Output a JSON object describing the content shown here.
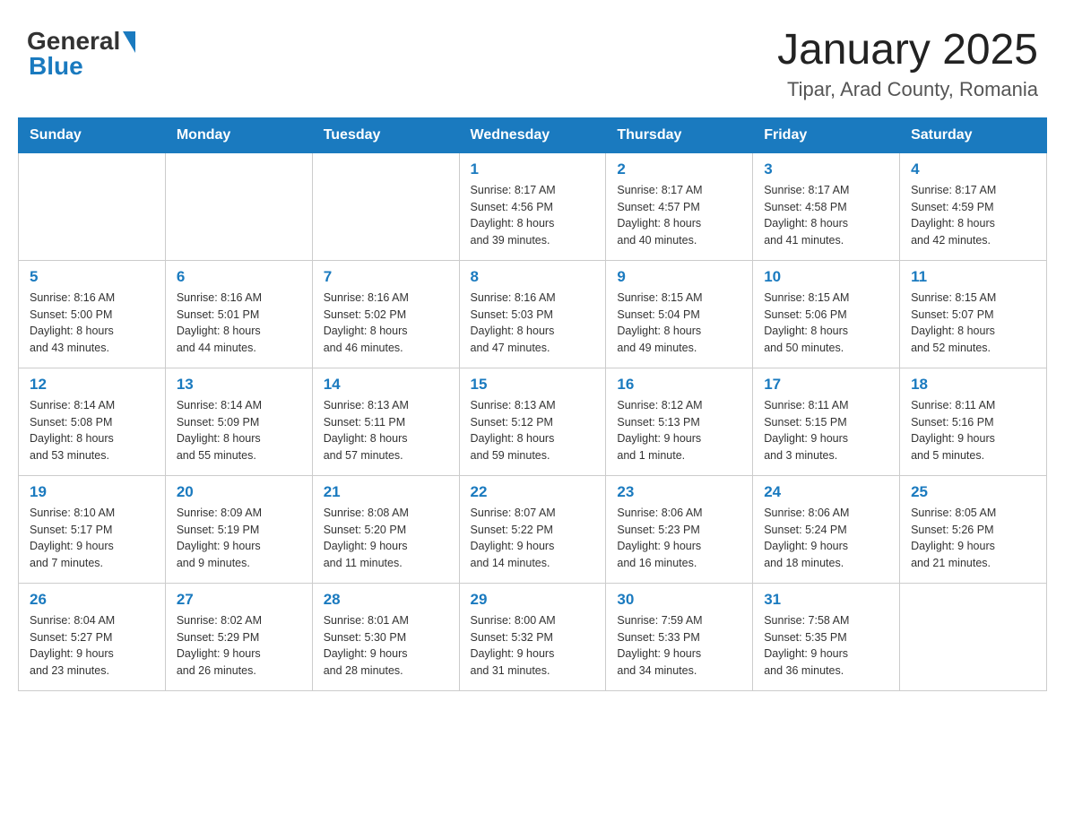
{
  "header": {
    "logo_general": "General",
    "logo_blue": "Blue",
    "title": "January 2025",
    "subtitle": "Tipar, Arad County, Romania"
  },
  "days_of_week": [
    "Sunday",
    "Monday",
    "Tuesday",
    "Wednesday",
    "Thursday",
    "Friday",
    "Saturday"
  ],
  "weeks": [
    [
      {
        "day": "",
        "info": ""
      },
      {
        "day": "",
        "info": ""
      },
      {
        "day": "",
        "info": ""
      },
      {
        "day": "1",
        "info": "Sunrise: 8:17 AM\nSunset: 4:56 PM\nDaylight: 8 hours\nand 39 minutes."
      },
      {
        "day": "2",
        "info": "Sunrise: 8:17 AM\nSunset: 4:57 PM\nDaylight: 8 hours\nand 40 minutes."
      },
      {
        "day": "3",
        "info": "Sunrise: 8:17 AM\nSunset: 4:58 PM\nDaylight: 8 hours\nand 41 minutes."
      },
      {
        "day": "4",
        "info": "Sunrise: 8:17 AM\nSunset: 4:59 PM\nDaylight: 8 hours\nand 42 minutes."
      }
    ],
    [
      {
        "day": "5",
        "info": "Sunrise: 8:16 AM\nSunset: 5:00 PM\nDaylight: 8 hours\nand 43 minutes."
      },
      {
        "day": "6",
        "info": "Sunrise: 8:16 AM\nSunset: 5:01 PM\nDaylight: 8 hours\nand 44 minutes."
      },
      {
        "day": "7",
        "info": "Sunrise: 8:16 AM\nSunset: 5:02 PM\nDaylight: 8 hours\nand 46 minutes."
      },
      {
        "day": "8",
        "info": "Sunrise: 8:16 AM\nSunset: 5:03 PM\nDaylight: 8 hours\nand 47 minutes."
      },
      {
        "day": "9",
        "info": "Sunrise: 8:15 AM\nSunset: 5:04 PM\nDaylight: 8 hours\nand 49 minutes."
      },
      {
        "day": "10",
        "info": "Sunrise: 8:15 AM\nSunset: 5:06 PM\nDaylight: 8 hours\nand 50 minutes."
      },
      {
        "day": "11",
        "info": "Sunrise: 8:15 AM\nSunset: 5:07 PM\nDaylight: 8 hours\nand 52 minutes."
      }
    ],
    [
      {
        "day": "12",
        "info": "Sunrise: 8:14 AM\nSunset: 5:08 PM\nDaylight: 8 hours\nand 53 minutes."
      },
      {
        "day": "13",
        "info": "Sunrise: 8:14 AM\nSunset: 5:09 PM\nDaylight: 8 hours\nand 55 minutes."
      },
      {
        "day": "14",
        "info": "Sunrise: 8:13 AM\nSunset: 5:11 PM\nDaylight: 8 hours\nand 57 minutes."
      },
      {
        "day": "15",
        "info": "Sunrise: 8:13 AM\nSunset: 5:12 PM\nDaylight: 8 hours\nand 59 minutes."
      },
      {
        "day": "16",
        "info": "Sunrise: 8:12 AM\nSunset: 5:13 PM\nDaylight: 9 hours\nand 1 minute."
      },
      {
        "day": "17",
        "info": "Sunrise: 8:11 AM\nSunset: 5:15 PM\nDaylight: 9 hours\nand 3 minutes."
      },
      {
        "day": "18",
        "info": "Sunrise: 8:11 AM\nSunset: 5:16 PM\nDaylight: 9 hours\nand 5 minutes."
      }
    ],
    [
      {
        "day": "19",
        "info": "Sunrise: 8:10 AM\nSunset: 5:17 PM\nDaylight: 9 hours\nand 7 minutes."
      },
      {
        "day": "20",
        "info": "Sunrise: 8:09 AM\nSunset: 5:19 PM\nDaylight: 9 hours\nand 9 minutes."
      },
      {
        "day": "21",
        "info": "Sunrise: 8:08 AM\nSunset: 5:20 PM\nDaylight: 9 hours\nand 11 minutes."
      },
      {
        "day": "22",
        "info": "Sunrise: 8:07 AM\nSunset: 5:22 PM\nDaylight: 9 hours\nand 14 minutes."
      },
      {
        "day": "23",
        "info": "Sunrise: 8:06 AM\nSunset: 5:23 PM\nDaylight: 9 hours\nand 16 minutes."
      },
      {
        "day": "24",
        "info": "Sunrise: 8:06 AM\nSunset: 5:24 PM\nDaylight: 9 hours\nand 18 minutes."
      },
      {
        "day": "25",
        "info": "Sunrise: 8:05 AM\nSunset: 5:26 PM\nDaylight: 9 hours\nand 21 minutes."
      }
    ],
    [
      {
        "day": "26",
        "info": "Sunrise: 8:04 AM\nSunset: 5:27 PM\nDaylight: 9 hours\nand 23 minutes."
      },
      {
        "day": "27",
        "info": "Sunrise: 8:02 AM\nSunset: 5:29 PM\nDaylight: 9 hours\nand 26 minutes."
      },
      {
        "day": "28",
        "info": "Sunrise: 8:01 AM\nSunset: 5:30 PM\nDaylight: 9 hours\nand 28 minutes."
      },
      {
        "day": "29",
        "info": "Sunrise: 8:00 AM\nSunset: 5:32 PM\nDaylight: 9 hours\nand 31 minutes."
      },
      {
        "day": "30",
        "info": "Sunrise: 7:59 AM\nSunset: 5:33 PM\nDaylight: 9 hours\nand 34 minutes."
      },
      {
        "day": "31",
        "info": "Sunrise: 7:58 AM\nSunset: 5:35 PM\nDaylight: 9 hours\nand 36 minutes."
      },
      {
        "day": "",
        "info": ""
      }
    ]
  ]
}
